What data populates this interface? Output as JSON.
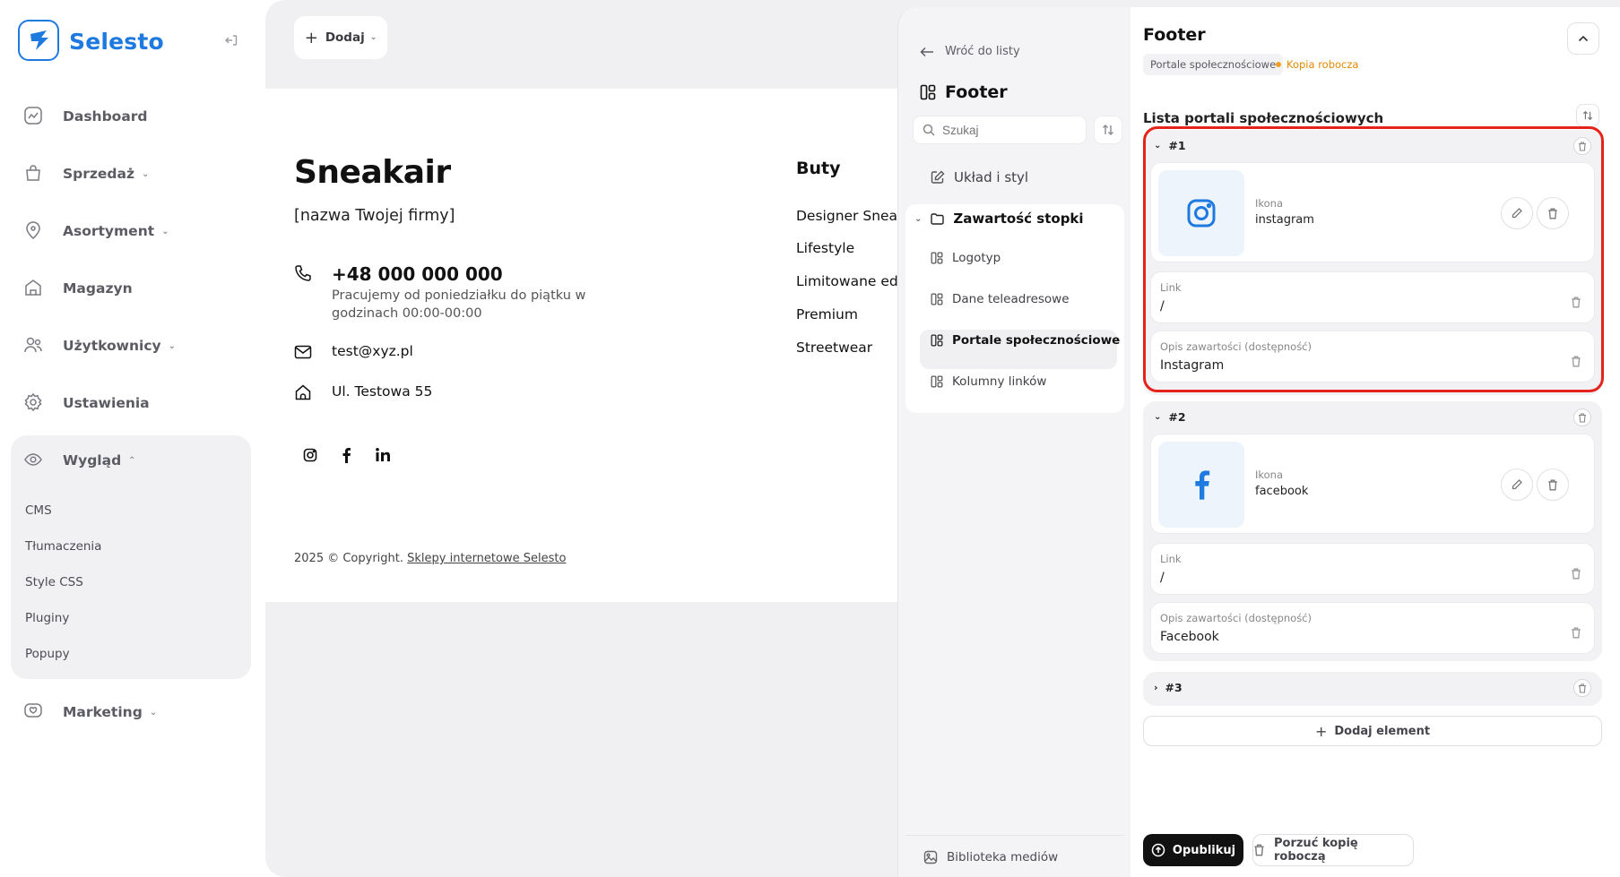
{
  "brand": {
    "name": "Selesto",
    "color": "#1f7ae0"
  },
  "sidebar": {
    "items": [
      {
        "label": "Dashboard",
        "icon": "chart-icon",
        "chevron": ""
      },
      {
        "label": "Sprzedaż",
        "icon": "bag-icon",
        "chevron": "⌄"
      },
      {
        "label": "Asortyment",
        "icon": "tag-icon",
        "chevron": "⌄"
      },
      {
        "label": "Magazyn",
        "icon": "warehouse-icon",
        "chevron": ""
      },
      {
        "label": "Użytkownicy",
        "icon": "users-icon",
        "chevron": "⌄"
      },
      {
        "label": "Ustawienia",
        "icon": "gear-icon",
        "chevron": ""
      },
      {
        "label": "Wygląd",
        "icon": "eye-icon",
        "chevron": "⌃"
      },
      {
        "label": "Marketing",
        "icon": "heart-chat-icon",
        "chevron": "⌄"
      }
    ],
    "sub_items": [
      "CMS",
      "Tłumaczenia",
      "Style CSS",
      "Pluginy",
      "Popupy"
    ]
  },
  "toolbar": {
    "add_label": "Dodaj"
  },
  "preview": {
    "company": "Sneakair",
    "company_sub": "[nazwa Twojej firmy]",
    "phone": "+48 000 000 000",
    "hours": "Pracujemy od poniedziałku do piątku w godzinach 00:00-00:00",
    "email": "test@xyz.pl",
    "address": "Ul. Testowa 55",
    "copyright_prefix": "2025 © Copyright.",
    "copyright_link": "Sklepy internetowe Selesto",
    "column_title": "Buty",
    "column_links": [
      "Designer Sneakers",
      "Lifestyle",
      "Limitowane edycje",
      "Premium",
      "Streetwear"
    ]
  },
  "outline": {
    "back_label": "Wróć do listy",
    "title": "Footer",
    "search_placeholder": "Szukaj",
    "layout_label": "Układ i styl",
    "content_label": "Zawartość stopki",
    "children": [
      "Logotyp",
      "Dane teleadresowe",
      "Portale społecznościowe",
      "Kolumny linków"
    ],
    "media_library": "Biblioteka mediów"
  },
  "editor": {
    "title": "Footer",
    "tag": "Portale społecznościowe",
    "draft": "Kopia robocza",
    "draft_color": "#e08a00",
    "section_title": "Lista portali społecznościowych",
    "icon_label": "Ikona",
    "link_label": "Link",
    "desc_label": "Opis zawartości (dostępność)",
    "items": [
      {
        "number": "#1",
        "icon": "instagram",
        "link": "/",
        "desc": "Instagram",
        "expanded": true
      },
      {
        "number": "#2",
        "icon": "facebook",
        "link": "/",
        "desc": "Facebook",
        "expanded": true
      },
      {
        "number": "#3",
        "expanded": false
      }
    ],
    "add_element": "Dodaj element",
    "publish": "Opublikuj",
    "discard": "Porzuć kopię roboczą",
    "highlight_color": "#e6231a"
  }
}
